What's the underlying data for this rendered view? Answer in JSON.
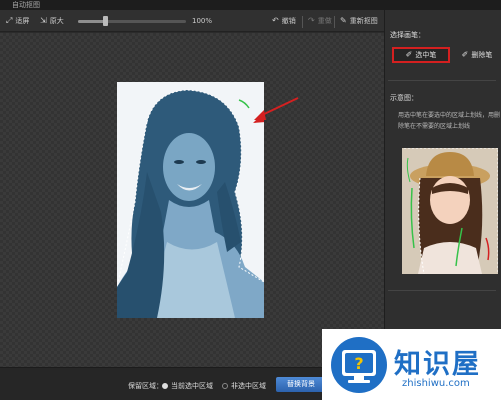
{
  "window": {
    "title": "自动抠图"
  },
  "toolbar": {
    "fit_label": "适屏",
    "original_label": "原大",
    "zoom": "100%",
    "undo_label": "撤销",
    "redo_label": "重做",
    "redraw_label": "重新抠图"
  },
  "panel": {
    "select_pen_heading": "选择画笔：",
    "select_pen_label": "选中笔",
    "erase_pen_label": "删除笔",
    "example_heading": "示意图：",
    "hint_text": "用选中笔在要选中的区域上划线，用删除笔在不需要的区域上划线"
  },
  "bottom": {
    "keep_area_label": "保留区域：",
    "option_current": "当前选中区域",
    "option_unselected": "非选中区域",
    "replace_bg_label": "替换背景"
  },
  "watermark": {
    "brand": "知识屋",
    "url": "zhishiwu.com"
  },
  "colors": {
    "accent_red": "#d42020",
    "button_blue": "#2c62ad",
    "brand_blue": "#1f6fc5"
  }
}
